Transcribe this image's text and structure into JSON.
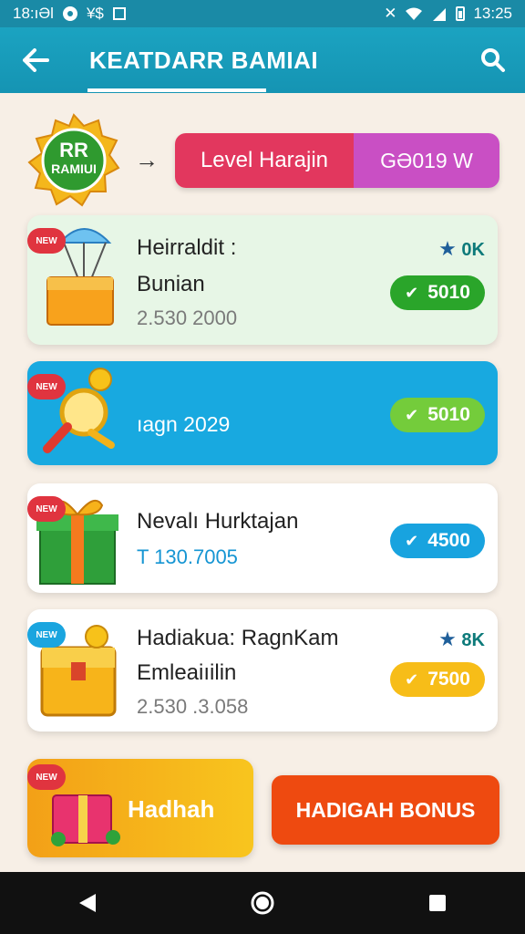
{
  "status_bar": {
    "time_left": "18:ıƏl",
    "glyph_left": "¥$",
    "time_right": "13:25"
  },
  "app_bar": {
    "title": "KEATDARR BAMIAI"
  },
  "level": {
    "medal_line1": "RR",
    "medal_line2": "RAMIUI",
    "label": "Level Harajin",
    "value": "GƏ019 W"
  },
  "cards": [
    {
      "title": "Heirraldit :",
      "subtitle": "Bunian",
      "meta": "2.530 2000",
      "star": "0K",
      "points": "5010"
    },
    {
      "meta": "ıagn 2029",
      "points": "5010"
    },
    {
      "title": "Nevalı Hurktajan",
      "meta": "T 130.7005",
      "points": "4500"
    },
    {
      "title": "Hadiakua: RagnKam",
      "subtitle": "Emleaiıilin",
      "meta": "2.530 .3.058",
      "star": "8K",
      "points": "7500"
    }
  ],
  "bottom": {
    "left_label": "Hadhah",
    "right_label": "HADIGAH BONUS"
  },
  "colors": {
    "primary": "#1ba3c1",
    "accent_red": "#e2375e",
    "accent_purple": "#c94fc4",
    "green": "#2aa52a",
    "blue": "#18a9e0",
    "yellow": "#f7bd18",
    "orange": "#ee4a10"
  }
}
